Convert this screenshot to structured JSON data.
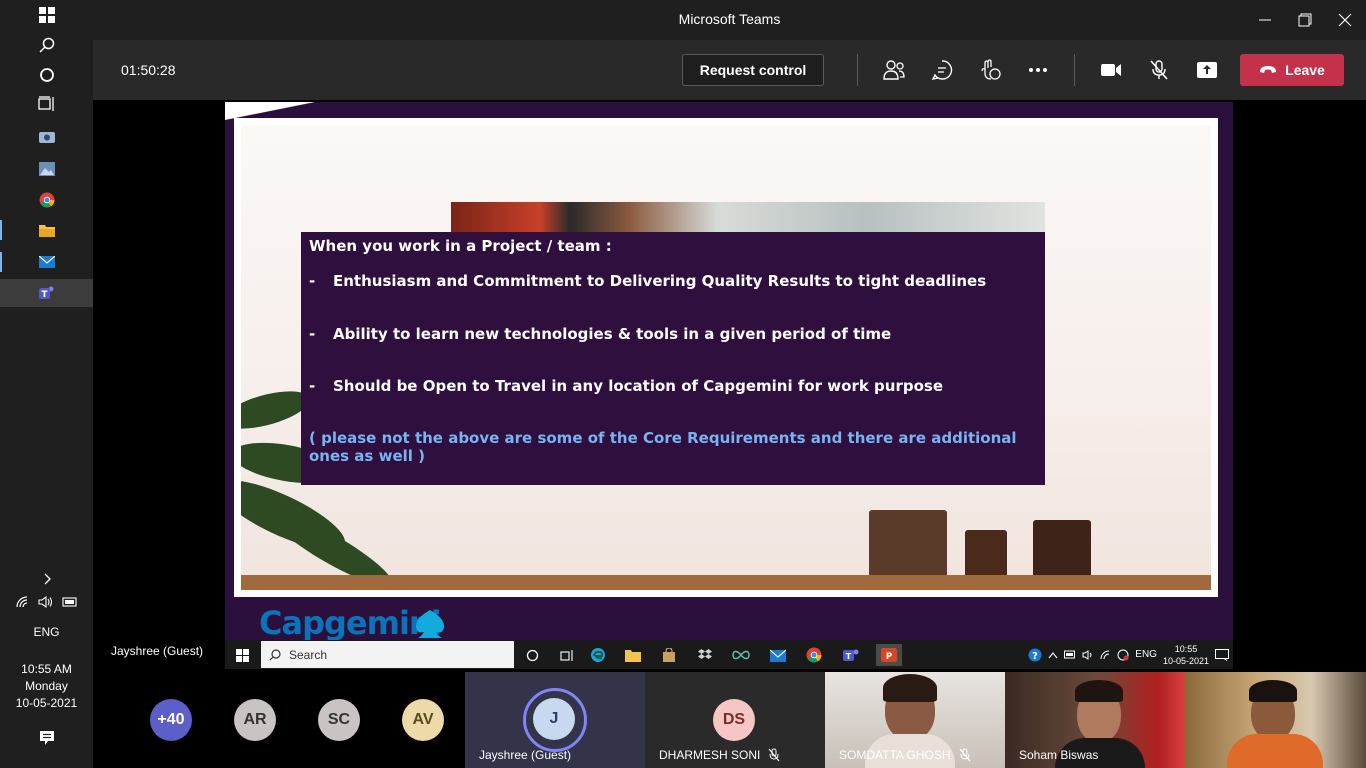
{
  "windows": {
    "sidebar_icons": [
      "windows-logo",
      "search",
      "cortana",
      "task-view",
      "camera",
      "photos",
      "chrome",
      "file-explorer",
      "mail",
      "teams"
    ],
    "tray_lang": "ENG",
    "clock": {
      "time": "10:55 AM",
      "day": "Monday",
      "date": "10-05-2021"
    }
  },
  "teams": {
    "window_title": "Microsoft Teams",
    "timer": "01:50:28",
    "request_control_label": "Request control",
    "leave_label": "Leave",
    "colors": {
      "leave": "#c4314b",
      "background": "#000000"
    }
  },
  "slide": {
    "heading": "When you work in a Project / team :",
    "items": [
      {
        "dash": "-",
        "text": "Enthusiasm and Commitment to Delivering Quality Results to tight deadlines"
      },
      {
        "dash": "-",
        "text": "Ability to learn new technologies & tools in a given period of time"
      },
      {
        "dash": "-",
        "text": "Should be Open to Travel in any location of Capgemini for work purpose"
      }
    ],
    "note": "( please not the above are some of the Core Requirements and there are additional ones as well )",
    "logo_text": "Capgemini"
  },
  "inner_taskbar": {
    "search_placeholder": "Search",
    "lang": "ENG",
    "time": "10:55",
    "date": "10-05-2021"
  },
  "presenter_name": "Jayshree (Guest)",
  "participants": {
    "overflow": "+40",
    "avatars": [
      {
        "initials": "AR",
        "bg": "#c9c3c3"
      },
      {
        "initials": "SC",
        "bg": "#c9c3c3"
      },
      {
        "initials": "AV",
        "bg": "#eed9a8"
      }
    ],
    "tiles": [
      {
        "initials": "J",
        "name": "Jayshree (Guest)"
      },
      {
        "initials": "DS",
        "name": "DHARMESH SONI"
      },
      {
        "name": "SOMDATTA GHOSH"
      },
      {
        "name": "Soham Biswas"
      },
      {
        "name": ""
      }
    ]
  }
}
